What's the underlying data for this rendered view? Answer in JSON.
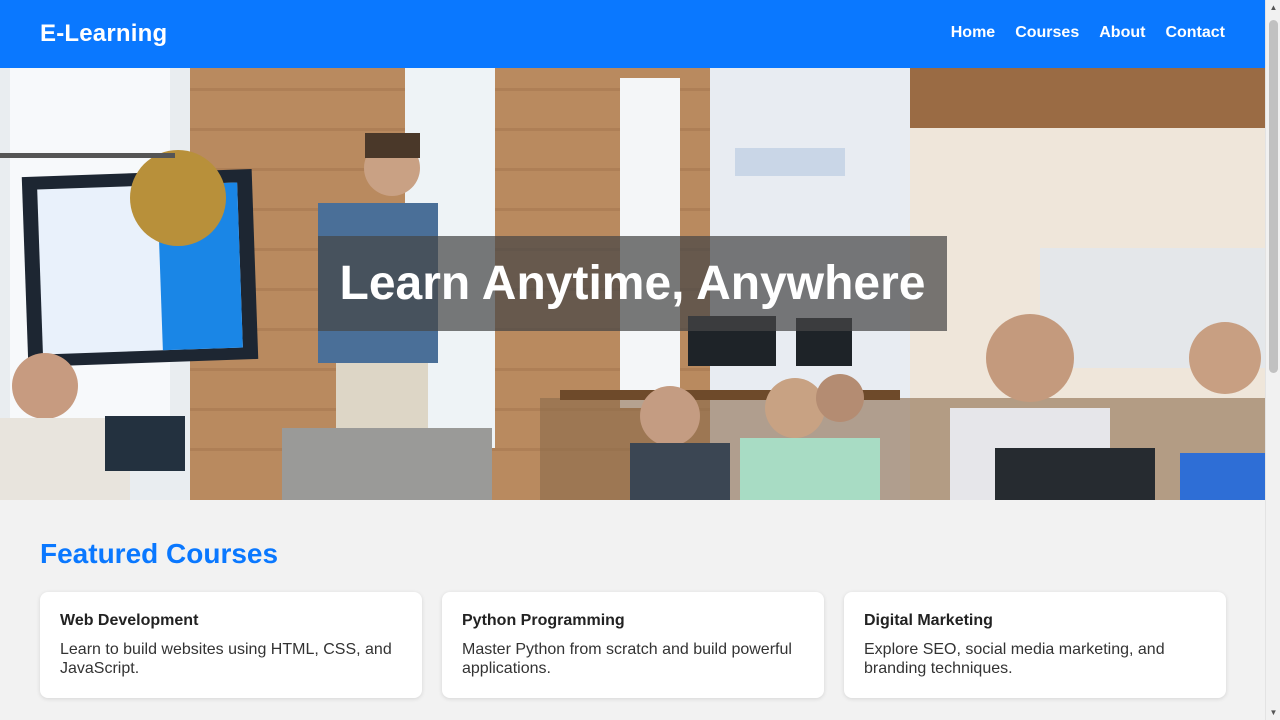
{
  "header": {
    "brand": "E-Learning",
    "nav": [
      {
        "label": "Home"
      },
      {
        "label": "Courses"
      },
      {
        "label": "About"
      },
      {
        "label": "Contact"
      }
    ]
  },
  "hero": {
    "title": "Learn Anytime, Anywhere"
  },
  "featured": {
    "heading": "Featured Courses",
    "courses": [
      {
        "title": "Web Development",
        "description": "Learn to build websites using HTML, CSS, and JavaScript."
      },
      {
        "title": "Python Programming",
        "description": "Master Python from scratch and build powerful applications."
      },
      {
        "title": "Digital Marketing",
        "description": "Explore SEO, social media marketing, and branding techniques."
      }
    ]
  },
  "colors": {
    "brand": "#0a78ff",
    "background": "#f2f2f2",
    "card": "#ffffff"
  }
}
